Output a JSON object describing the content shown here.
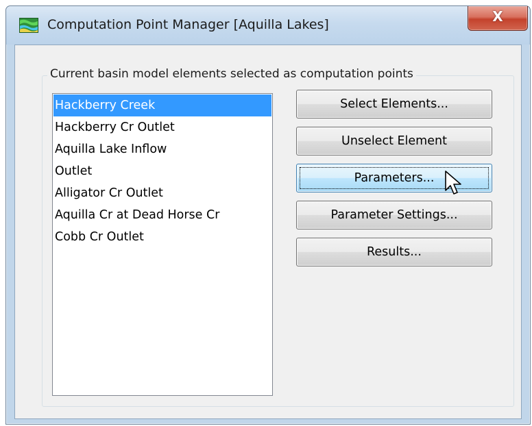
{
  "window": {
    "title": "Computation Point Manager [Aquilla Lakes]",
    "close_glyph": "X"
  },
  "group": {
    "label": "Current basin model elements selected as computation points"
  },
  "list": {
    "items": [
      "Hackberry Creek",
      "Hackberry Cr Outlet",
      "Aquilla Lake Inflow",
      "Outlet",
      "Alligator Cr Outlet",
      "Aquilla Cr at Dead Horse Cr",
      "Cobb Cr Outlet"
    ],
    "selected": "Hackberry Creek"
  },
  "buttons": {
    "select_elements": "Select Elements...",
    "unselect_element": "Unselect Element",
    "parameters": "Parameters...",
    "parameter_settings": "Parameter Settings...",
    "results": "Results..."
  },
  "colors": {
    "selection": "#3399ff",
    "title_bar": "#c6daee",
    "close_button": "#c4422c"
  },
  "icons": {
    "app": "hec-hms-basin-icon",
    "close": "close-icon",
    "cursor": "mouse-pointer-icon"
  }
}
